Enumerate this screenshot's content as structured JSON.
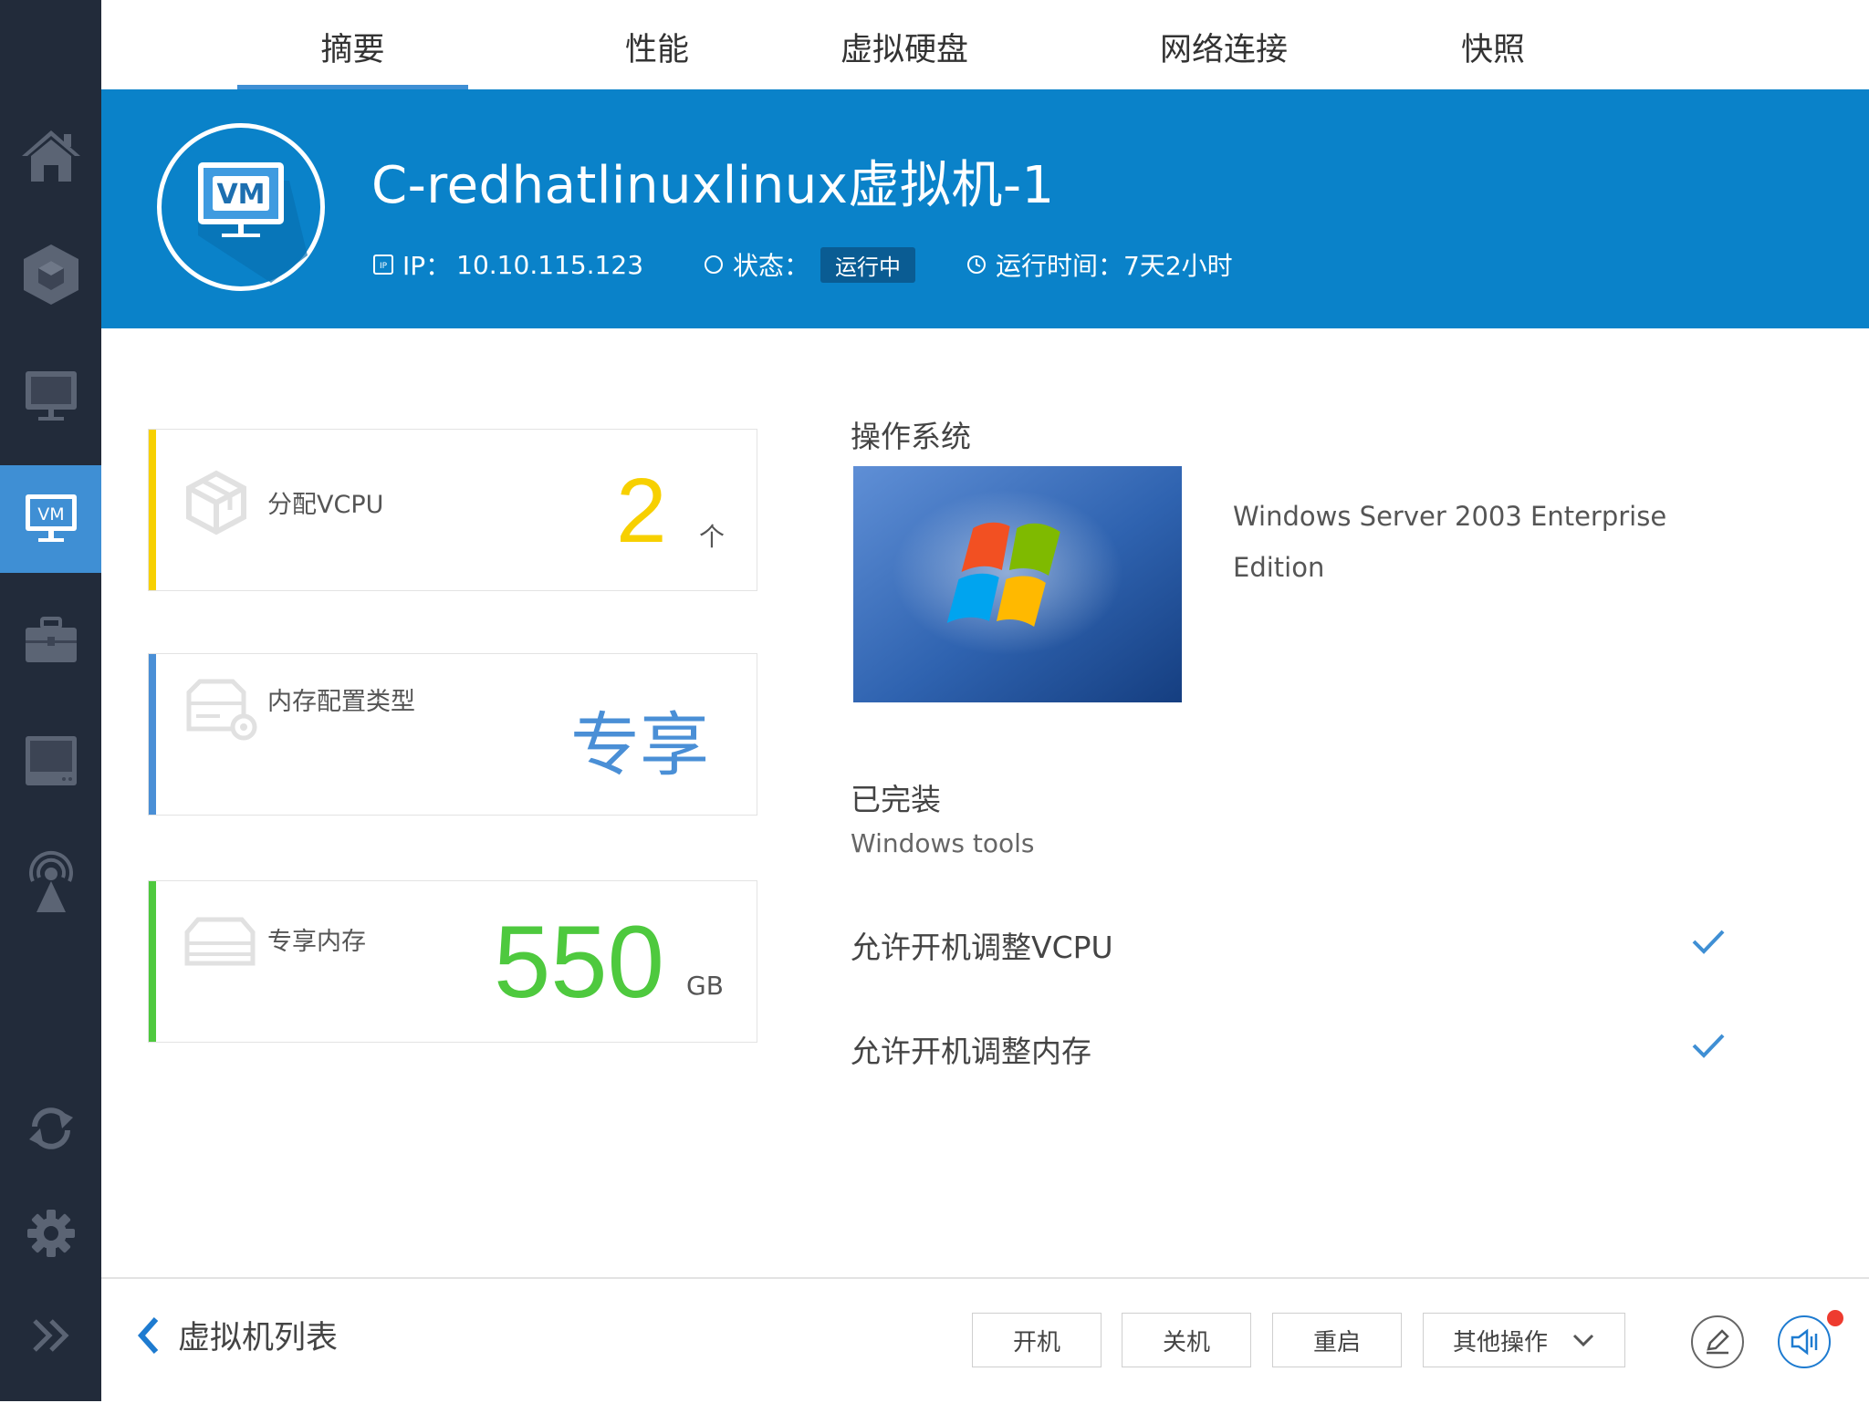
{
  "colors": {
    "sidebar_bg": "#222b3a",
    "accent_blue": "#3f8fd4",
    "banner_blue": "#0a82c9",
    "vcpu_yellow": "#f7d000",
    "memtype_blue": "#4a8fd6",
    "memory_green": "#4ec93e"
  },
  "sidebar": {
    "items": [
      {
        "icon": "home-icon"
      },
      {
        "icon": "cube-icon"
      },
      {
        "icon": "monitor-icon"
      },
      {
        "icon": "vm-icon",
        "active": true
      },
      {
        "icon": "briefcase-icon"
      },
      {
        "icon": "storage-icon"
      },
      {
        "icon": "broadcast-icon"
      },
      {
        "icon": "refresh-icon"
      },
      {
        "icon": "gear-icon"
      },
      {
        "icon": "double-chevron-right-icon"
      }
    ]
  },
  "tabs": [
    {
      "label": "摘要",
      "active": true
    },
    {
      "label": "性能"
    },
    {
      "label": "虚拟硬盘"
    },
    {
      "label": "网络连接"
    },
    {
      "label": "快照"
    }
  ],
  "header": {
    "avatar_text": "VM",
    "vm_name": "C-redhatlinuxlinux虚拟机-1",
    "ip_label": "IP：",
    "ip_value": "10.10.115.123",
    "status_label": "状态：",
    "status_value": "运行中",
    "uptime_label": "运行时间：",
    "uptime_value": "7天2小时"
  },
  "cards": {
    "vcpu": {
      "label": "分配VCPU",
      "value": "2",
      "unit": "个"
    },
    "memory_type": {
      "label": "内存配置类型",
      "value": "专享"
    },
    "dedicated_memory": {
      "label": "专享内存",
      "value": "550",
      "unit": "GB"
    }
  },
  "os": {
    "title": "操作系统",
    "name": "Windows Server 2003 Enterprise Edition"
  },
  "tools": {
    "title": "已完装",
    "name": "Windows tools"
  },
  "permissions": [
    {
      "label": "允许开机调整VCPU",
      "enabled": true
    },
    {
      "label": "允许开机调整内存",
      "enabled": true
    }
  ],
  "footer": {
    "back_label": "虚拟机列表",
    "buttons": {
      "power_on": "开机",
      "power_off": "关机",
      "restart": "重启",
      "more": "其他操作"
    }
  }
}
